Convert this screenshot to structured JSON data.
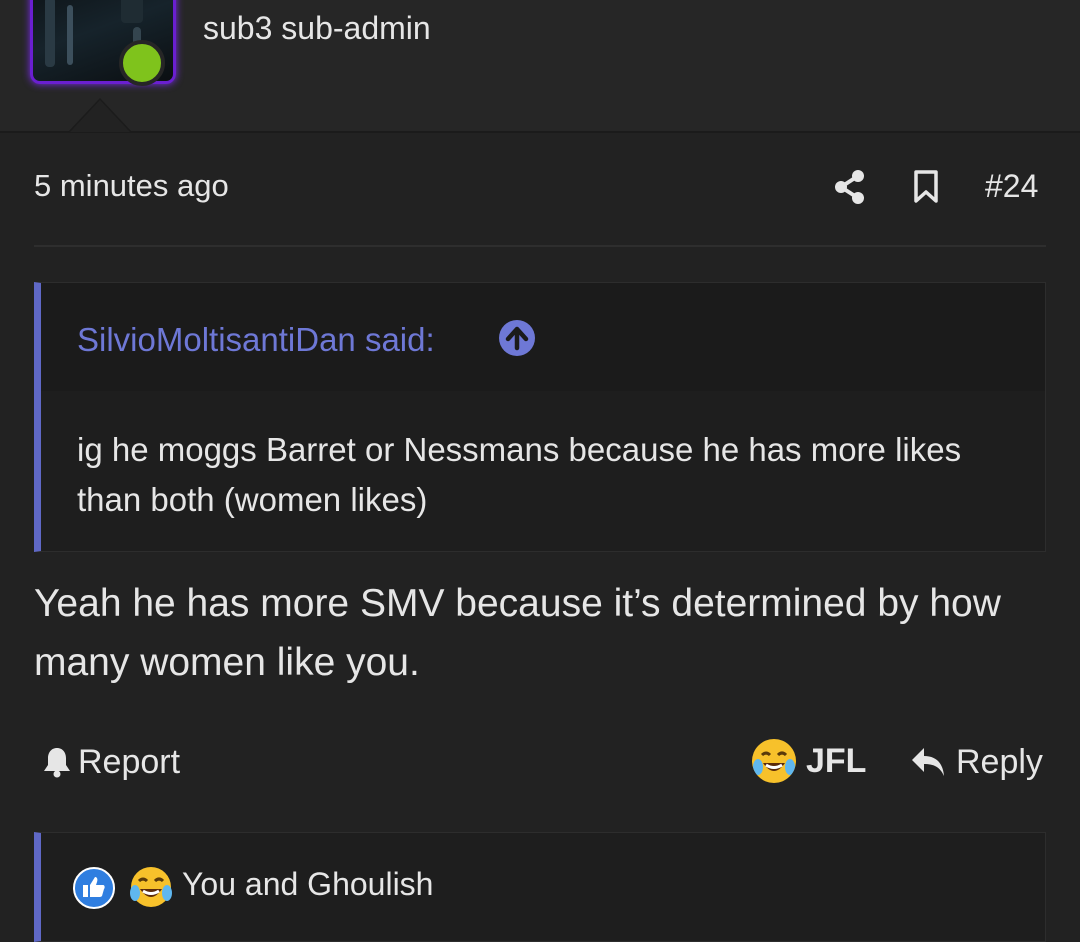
{
  "user": {
    "title": "sub3 sub-admin",
    "status": "online"
  },
  "post": {
    "time": "5 minutes ago",
    "number": "#24",
    "body": "Yeah he has more SMV because it’s determined by how many women like you."
  },
  "quote": {
    "author": "SilvioMoltisantiDan said:",
    "text": "ig he moggs Barret or Nessmans because he has more likes than both (women likes)"
  },
  "actions": {
    "report_label": "Report",
    "jfl_label": "JFL",
    "reply_label": "Reply"
  },
  "reactions": {
    "summary": "You and Ghoulish",
    "icons": [
      "like-icon",
      "laughing-crying-emoji-icon"
    ]
  },
  "colors": {
    "background": "#222222",
    "accent": "#6e78d6",
    "online": "#7fc31c",
    "avatar_border": "#6a1fd0"
  }
}
